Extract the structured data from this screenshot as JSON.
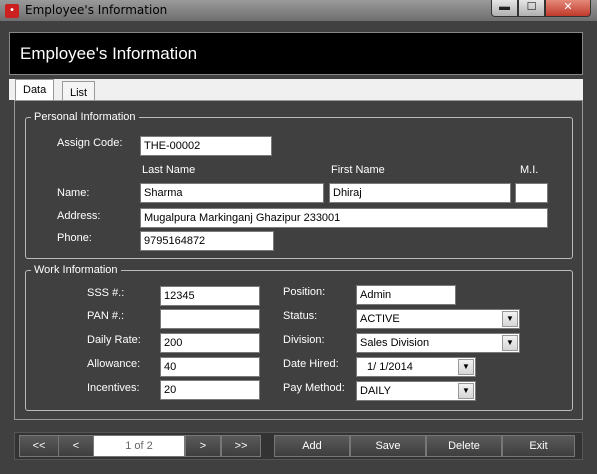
{
  "window": {
    "title": "Employee's Information",
    "controls": {
      "minimize": "▬",
      "maximize": "☐",
      "close": "✕"
    }
  },
  "header": {
    "title": "Employee's Information"
  },
  "tabs": [
    {
      "label": "Data"
    },
    {
      "label": "List"
    }
  ],
  "personal": {
    "legend": "Personal Information",
    "assign_code_label": "Assign Code:",
    "assign_code": "THE-00002",
    "col_last_name": "Last Name",
    "col_first_name": "First Name",
    "col_mi": "M.I.",
    "name_label": "Name:",
    "last_name": "Sharma",
    "first_name": "Dhiraj",
    "mi": "",
    "address_label": "Address:",
    "address": "Mugalpura Markinganj Ghazipur 233001",
    "phone_label": "Phone:",
    "phone": "9795164872"
  },
  "work": {
    "legend": "Work Information",
    "sss_label": "SSS #.:",
    "sss": "12345",
    "pan_label": "PAN #.:",
    "pan": "",
    "daily_rate_label": "Daily Rate:",
    "daily_rate": "200",
    "allowance_label": "Allowance:",
    "allowance": "40",
    "incentives_label": "Incentives:",
    "incentives": "20",
    "position_label": "Position:",
    "position": "Admin",
    "status_label": "Status:",
    "status": "ACTIVE",
    "division_label": "Division:",
    "division": "Sales Division",
    "date_hired_label": "Date Hired:",
    "date_hired": "1/  1/2014",
    "pay_method_label": "Pay Method:",
    "pay_method": "DAILY"
  },
  "navigation": {
    "first": "<<",
    "prev": "<",
    "page_info": "1 of 2",
    "next": ">",
    "last": ">>"
  },
  "actions": {
    "add": "Add",
    "save": "Save",
    "delete": "Delete",
    "exit": "Exit"
  },
  "icons": {
    "app": "app-icon",
    "dropdown": "▼"
  }
}
